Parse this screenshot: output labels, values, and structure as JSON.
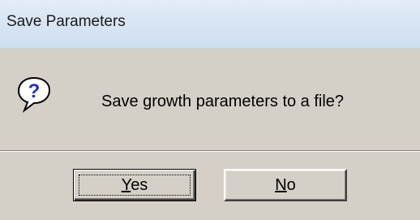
{
  "window": {
    "title": "Save Parameters"
  },
  "message": {
    "text": "Save growth parameters to a file?",
    "icon": "question-icon"
  },
  "buttons": {
    "yes": {
      "mnemonic": "Y",
      "rest": "es"
    },
    "no": {
      "mnemonic": "N",
      "rest": "o"
    }
  },
  "colors": {
    "dialog_bg": "#d4d0c8",
    "title_bg": "#d6e4f3",
    "icon_blue": "#1a2fd4"
  }
}
